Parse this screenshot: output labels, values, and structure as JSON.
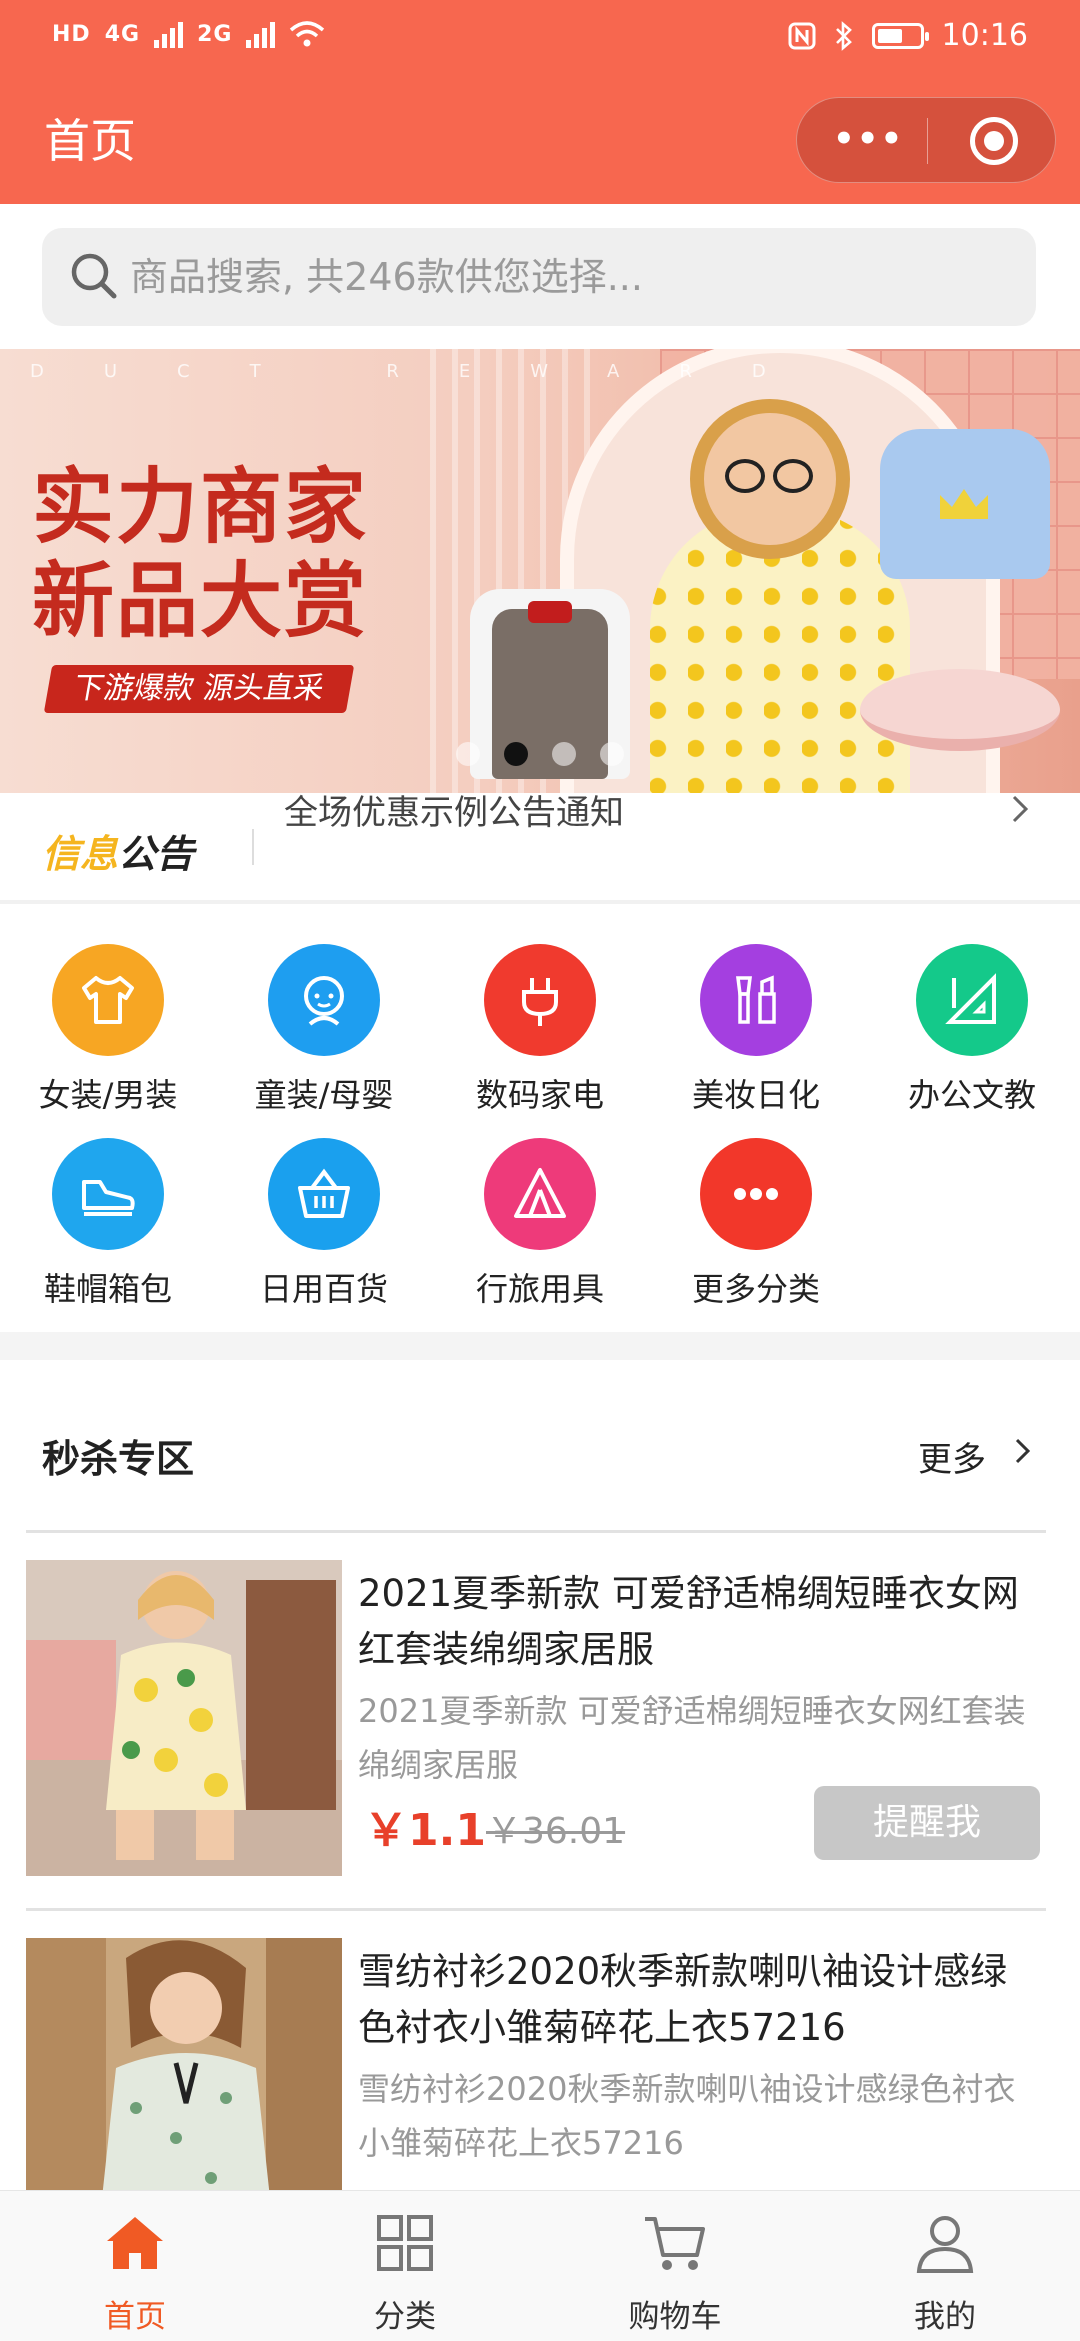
{
  "status_bar": {
    "left_text": "HD",
    "net1": "4G",
    "net2": "2G",
    "time": "10:16",
    "battery_level": 0.6
  },
  "nav": {
    "title": "首页"
  },
  "search": {
    "placeholder": "商品搜索, 共246款供您选择..."
  },
  "banner": {
    "watermark": "DUCT REWARD",
    "headline_1": "实力商家",
    "headline_2": "新品大赏",
    "tagline": "下游爆款 源头直采",
    "active_slide": 2,
    "slide_count": 4
  },
  "notice": {
    "brand_a": "信息",
    "brand_b": "公告",
    "text": "全场优惠示例公告通知"
  },
  "categories": [
    {
      "label": "女装/男装",
      "icon": "tshirt-icon",
      "color": "#f7a623"
    },
    {
      "label": "童装/母婴",
      "icon": "baby-icon",
      "color": "#1e9ef0"
    },
    {
      "label": "数码家电",
      "icon": "plug-icon",
      "color": "#f03a2e"
    },
    {
      "label": "美妆日化",
      "icon": "makeup-icon",
      "color": "#a43fe0"
    },
    {
      "label": "办公文教",
      "icon": "ruler-icon",
      "color": "#14c98a"
    },
    {
      "label": "鞋帽箱包",
      "icon": "shoe-icon",
      "color": "#1fa6ee"
    },
    {
      "label": "日用百货",
      "icon": "basket-icon",
      "color": "#1aa0ee"
    },
    {
      "label": "行旅用具",
      "icon": "tent-icon",
      "color": "#ee3a7a"
    },
    {
      "label": "更多分类",
      "icon": "more-icon",
      "color": "#f2372a"
    }
  ],
  "flash_sale": {
    "title": "秒杀专区",
    "more": "更多",
    "items": [
      {
        "title": "2021夏季新款 可爱舒适棉绸短睡衣女网红套装绵绸家居服",
        "desc": "2021夏季新款 可爱舒适棉绸短睡衣女网红套装绵绸家居服",
        "price": "￥1.1",
        "old_price": "￥36.01",
        "button": "提醒我"
      },
      {
        "title": "雪纺衬衫2020秋季新款喇叭袖设计感绿色衬衣小雏菊碎花上衣57216",
        "desc": "雪纺衬衫2020秋季新款喇叭袖设计感绿色衬衣小雏菊碎花上衣57216"
      }
    ]
  },
  "tabbar": {
    "tabs": [
      {
        "label": "首页",
        "icon": "home-icon",
        "active": true
      },
      {
        "label": "分类",
        "icon": "grid-icon",
        "active": false
      },
      {
        "label": "购物车",
        "icon": "cart-icon",
        "active": false
      },
      {
        "label": "我的",
        "icon": "user-icon",
        "active": false
      }
    ]
  },
  "colors": {
    "brand": "#f7674f",
    "price": "#e8402a",
    "tab_active": "#f05a24"
  }
}
